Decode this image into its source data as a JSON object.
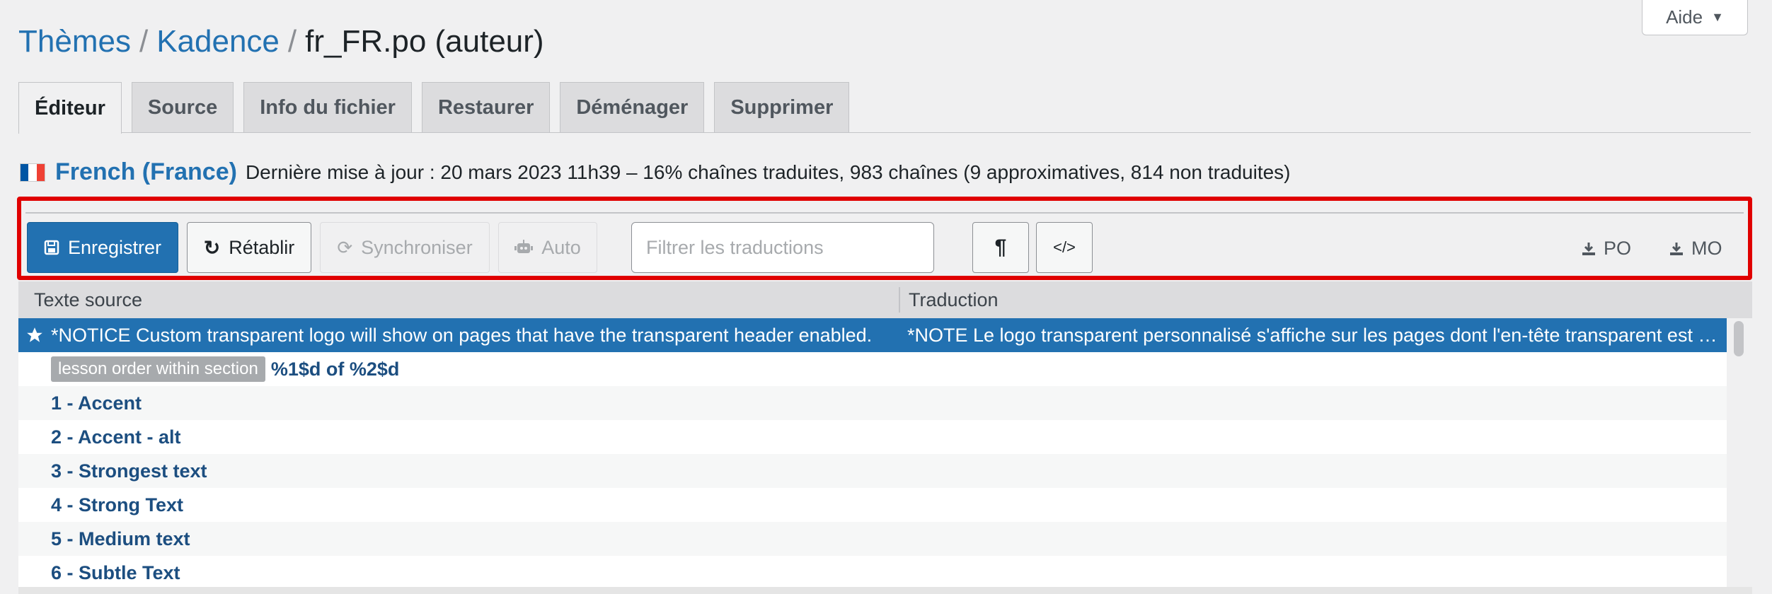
{
  "help": {
    "label": "Aide"
  },
  "breadcrumb": {
    "item1": "Thèmes",
    "item2": "Kadence",
    "current": "fr_FR.po (auteur)",
    "sep": "/"
  },
  "tabs": [
    {
      "label": "Éditeur"
    },
    {
      "label": "Source"
    },
    {
      "label": "Info du fichier"
    },
    {
      "label": "Restaurer"
    },
    {
      "label": "Déménager"
    },
    {
      "label": "Supprimer"
    }
  ],
  "locale": {
    "name": "French (France)",
    "status": "Dernière mise à jour : 20 mars 2023 11h39 – 16% chaînes traduites, 983 chaînes (9 approximatives, 814 non traduites)"
  },
  "toolbar": {
    "save_label": "Enregistrer",
    "revert_label": "Rétablir",
    "sync_label": "Synchroniser",
    "auto_label": "Auto",
    "filter_placeholder": "Filtrer les traductions",
    "pilcrow": "¶",
    "code": "</>",
    "po_label": "PO",
    "mo_label": "MO"
  },
  "grid": {
    "headers": {
      "source": "Texte source",
      "translation": "Traduction"
    },
    "rows": [
      {
        "source": "*NOTICE Custom transparent logo will show on pages that have the transparent header enabled.",
        "translation": "*NOTE Le logo transparent personnalisé s'affiche sur les pages dont l'en-tête transparent est activé."
      },
      {
        "context": "lesson order within section",
        "source": "%1$d of %2$d",
        "translation": ""
      },
      {
        "source": "1 - Accent",
        "translation": ""
      },
      {
        "source": "2 - Accent - alt",
        "translation": ""
      },
      {
        "source": "3 - Strongest text",
        "translation": ""
      },
      {
        "source": "4 - Strong Text",
        "translation": ""
      },
      {
        "source": "5 - Medium text",
        "translation": ""
      },
      {
        "source": "6 - Subtle Text",
        "translation": ""
      }
    ]
  },
  "colors": {
    "accent": "#2271b1",
    "highlight": "#e00000"
  }
}
